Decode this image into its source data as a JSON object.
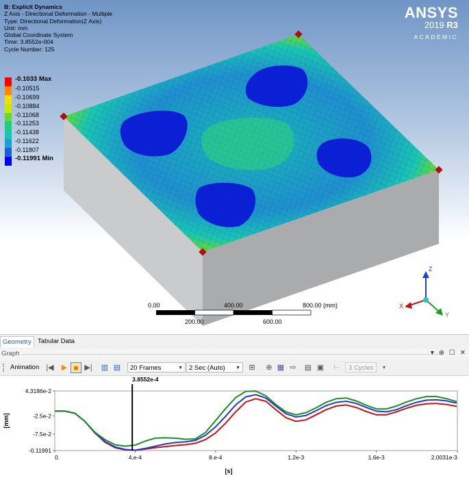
{
  "info": {
    "title": "B: Explicit Dynamics",
    "lines": [
      "Z Axis - Directional Deformation - Multiple",
      "Type: Directional Deformation(Z Axis)",
      "Unit: mm",
      "Global Coordinate System",
      "Time: 3.8552e-004",
      "Cycle Number: 125"
    ]
  },
  "logo": {
    "brand": "ANSYS",
    "version_year": "2019",
    "version_release": "R3",
    "edition": "ACADEMIC"
  },
  "legend": {
    "labels": [
      "-0.1033 Max",
      "-0.10515",
      "-0.10699",
      "-0.10884",
      "-0.11068",
      "-0.11253",
      "-0.11438",
      "-0.11622",
      "-0.11807",
      "-0.11991 Min"
    ],
    "colors": [
      "#ff0000",
      "#ff8800",
      "#ffdd00",
      "#c8e800",
      "#66d834",
      "#1fd07a",
      "#19c6b4",
      "#1aa0d8",
      "#1a5ed8",
      "#0000ff"
    ]
  },
  "scale_bar": {
    "top_labels": [
      "0.00",
      "400.00",
      "800.00 (mm)"
    ],
    "bottom_labels": [
      "200.00",
      "600.00"
    ]
  },
  "triad": {
    "z": "Z",
    "x": "X",
    "y": "Y"
  },
  "tabs": [
    {
      "label": "Geometry",
      "active": true
    },
    {
      "label": "Tabular Data",
      "active": false
    }
  ],
  "graph_panel": {
    "title": "Graph",
    "controls": "▾ ⊕ ☐ ✕"
  },
  "toolbar": {
    "animation_label": "Animation",
    "frames": "20 Frames",
    "duration": "2 Sec (Auto)",
    "cycles": "3 Cycles"
  },
  "chart_data": {
    "type": "line",
    "xlabel": "[s]",
    "ylabel": "[mm]",
    "xlim": [
      0,
      0.0020031
    ],
    "ylim": [
      -0.11991,
      0.043186
    ],
    "x_ticks": [
      {
        "v": 0,
        "label": "0."
      },
      {
        "v": 0.0004,
        "label": "4.e-4"
      },
      {
        "v": 0.0008,
        "label": "8.e-4"
      },
      {
        "v": 0.0012,
        "label": "1.2e-3"
      },
      {
        "v": 0.0016,
        "label": "1.6e-3"
      },
      {
        "v": 0.0020031,
        "label": "2.0031e-3"
      }
    ],
    "y_ticks": [
      {
        "v": 0.043186,
        "label": "4.3186e-2"
      },
      {
        "v": -0.025,
        "label": "-2.5e-2"
      },
      {
        "v": -0.075,
        "label": "-7.5e-2"
      },
      {
        "v": -0.11991,
        "label": "-0.11991"
      }
    ],
    "cursor": {
      "x": 0.00038552,
      "label": "3.8552e-4"
    },
    "series": [
      {
        "color": "#cc1111",
        "x": [
          0,
          5e-05,
          0.0001,
          0.00015,
          0.0002,
          0.00025,
          0.0003,
          0.00035,
          0.0004,
          0.00045,
          0.0005,
          0.00055,
          0.0006,
          0.00065,
          0.0007,
          0.00075,
          0.0008,
          0.00085,
          0.0009,
          0.00095,
          0.001,
          0.00105,
          0.0011,
          0.00115,
          0.0012,
          0.00125,
          0.0013,
          0.00135,
          0.0014,
          0.00145,
          0.0015,
          0.00155,
          0.0016,
          0.00165,
          0.0017,
          0.00175,
          0.0018,
          0.00185,
          0.0019,
          0.00195,
          0.002
        ],
        "y": [
          -0.012,
          -0.012,
          -0.018,
          -0.04,
          -0.072,
          -0.097,
          -0.112,
          -0.118,
          -0.119,
          -0.116,
          -0.112,
          -0.109,
          -0.106,
          -0.104,
          -0.1,
          -0.09,
          -0.072,
          -0.045,
          -0.014,
          0.013,
          0.022,
          0.015,
          -0.008,
          -0.03,
          -0.04,
          -0.036,
          -0.022,
          -0.008,
          0.002,
          0.005,
          -0.002,
          -0.013,
          -0.022,
          -0.022,
          -0.014,
          -0.004,
          0.004,
          0.008,
          0.009,
          0.006,
          0.001
        ]
      },
      {
        "color": "#1a3ccc",
        "x": [
          0,
          5e-05,
          0.0001,
          0.00015,
          0.0002,
          0.00025,
          0.0003,
          0.00035,
          0.0004,
          0.00045,
          0.0005,
          0.00055,
          0.0006,
          0.00065,
          0.0007,
          0.00075,
          0.0008,
          0.00085,
          0.0009,
          0.00095,
          0.001,
          0.00105,
          0.0011,
          0.00115,
          0.0012,
          0.00125,
          0.0013,
          0.00135,
          0.0014,
          0.00145,
          0.0015,
          0.00155,
          0.0016,
          0.00165,
          0.0017,
          0.00175,
          0.0018,
          0.00185,
          0.0019,
          0.00195,
          0.002
        ],
        "y": [
          -0.012,
          -0.012,
          -0.018,
          -0.04,
          -0.072,
          -0.095,
          -0.11,
          -0.117,
          -0.119,
          -0.114,
          -0.108,
          -0.102,
          -0.098,
          -0.096,
          -0.092,
          -0.078,
          -0.055,
          -0.026,
          0.005,
          0.027,
          0.033,
          0.024,
          0.002,
          -0.019,
          -0.028,
          -0.024,
          -0.011,
          0.003,
          0.012,
          0.015,
          0.009,
          -0.002,
          -0.012,
          -0.014,
          -0.008,
          0.003,
          0.012,
          0.018,
          0.019,
          0.016,
          0.01
        ]
      },
      {
        "color": "#1f8a2a",
        "x": [
          0,
          5e-05,
          0.0001,
          0.00015,
          0.0002,
          0.00025,
          0.0003,
          0.00035,
          0.0004,
          0.00045,
          0.0005,
          0.00055,
          0.0006,
          0.00065,
          0.0007,
          0.00075,
          0.0008,
          0.00085,
          0.0009,
          0.00095,
          0.001,
          0.00105,
          0.0011,
          0.00115,
          0.0012,
          0.00125,
          0.0013,
          0.00135,
          0.0014,
          0.00145,
          0.0015,
          0.00155,
          0.0016,
          0.00165,
          0.0017,
          0.00175,
          0.0018,
          0.00185,
          0.0019,
          0.00195,
          0.002
        ],
        "y": [
          -0.012,
          -0.012,
          -0.018,
          -0.04,
          -0.07,
          -0.09,
          -0.104,
          -0.108,
          -0.105,
          -0.094,
          -0.086,
          -0.085,
          -0.086,
          -0.089,
          -0.088,
          -0.07,
          -0.038,
          -0.005,
          0.025,
          0.042,
          0.043,
          0.03,
          0.006,
          -0.014,
          -0.022,
          -0.016,
          -0.003,
          0.012,
          0.022,
          0.024,
          0.016,
          0.004,
          -0.006,
          -0.006,
          0.002,
          0.013,
          0.022,
          0.028,
          0.028,
          0.022,
          0.014
        ]
      }
    ]
  }
}
